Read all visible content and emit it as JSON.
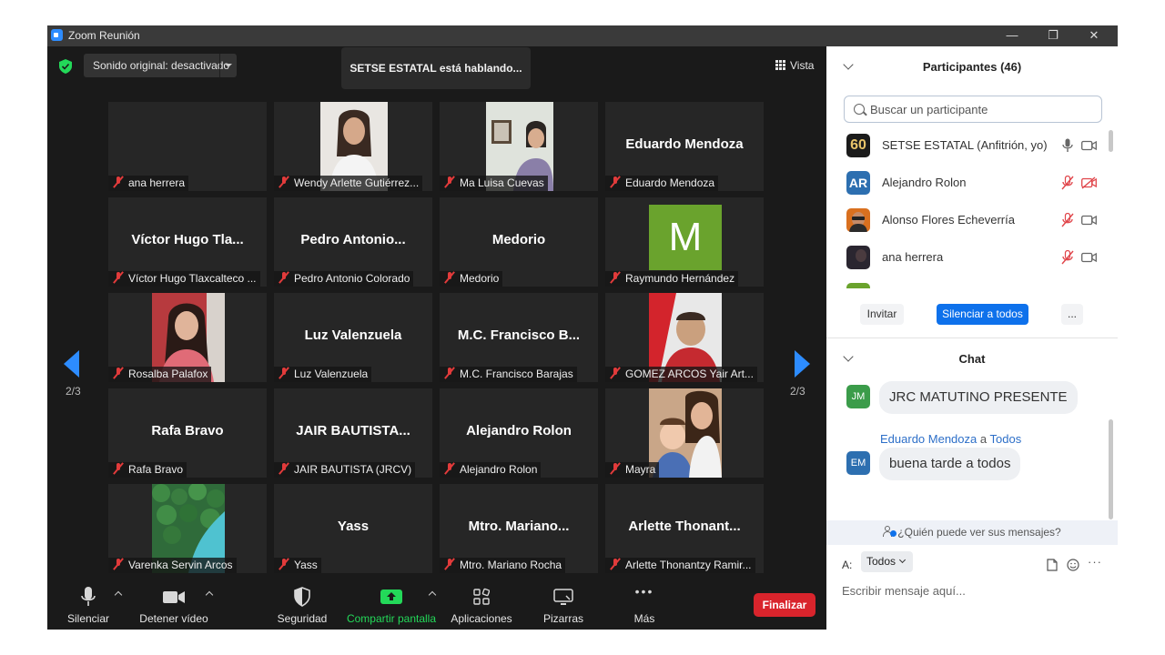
{
  "window": {
    "title": "Zoom Reunión",
    "controls": [
      "—",
      "❐",
      "✕"
    ]
  },
  "meeting": {
    "audio_label": "Sonido original: desactivado",
    "speaking": "SETSE ESTATAL está hablando...",
    "view_label": "Vista",
    "page_left": "2/3",
    "page_right": "2/3"
  },
  "tiles": [
    {
      "big": "",
      "name": "ana herrera"
    },
    {
      "big": "",
      "name": "Wendy  Arlette Gutiérrez..."
    },
    {
      "big": "",
      "name": "Ma Luisa Cuevas"
    },
    {
      "big": "Eduardo Mendoza",
      "name": "Eduardo Mendoza"
    },
    {
      "big": "Víctor  Hugo  Tla...",
      "name": "Víctor Hugo Tlaxcalteco ..."
    },
    {
      "big": "Pedro  Antonio...",
      "name": "Pedro Antonio Colorado"
    },
    {
      "big": "Medorio",
      "name": "Medorio"
    },
    {
      "big": "",
      "name": "Raymundo Hernández",
      "avatar_letter": "M"
    },
    {
      "big": "",
      "name": "Rosalba Palafox"
    },
    {
      "big": "Luz Valenzuela",
      "name": "Luz Valenzuela"
    },
    {
      "big": "M.C.  Francisco  B...",
      "name": "M.C. Francisco Barajas"
    },
    {
      "big": "",
      "name": "GOMEZ ARCOS Yair Art..."
    },
    {
      "big": "Rafa Bravo",
      "name": "Rafa Bravo"
    },
    {
      "big": "JAIR BAUTISTA...",
      "name": "JAIR BAUTISTA (JRCV)"
    },
    {
      "big": "Alejandro Rolon",
      "name": "Alejandro Rolon"
    },
    {
      "big": "",
      "name": "Mayra"
    },
    {
      "big": "",
      "name": "Varenka Servin Arcos"
    },
    {
      "big": "Yass",
      "name": "Yass"
    },
    {
      "big": "Mtro.  Mariano...",
      "name": "Mtro. Mariano Rocha"
    },
    {
      "big": "Arlette  Thonant...",
      "name": "Arlette Thonantzy Ramir..."
    }
  ],
  "toolbar": {
    "mute": "Silenciar",
    "video": "Detener vídeo",
    "security": "Seguridad",
    "share": "Compartir pantalla",
    "apps": "Aplicaciones",
    "whiteboards": "Pizarras",
    "more": "Más",
    "end": "Finalizar",
    "more_glyph": "•••"
  },
  "participants": {
    "title": "Participantes (46)",
    "search_placeholder": "Buscar un participante",
    "list": [
      {
        "name": "SETSE ESTATAL (Anfitrión, yo)",
        "initials": "60",
        "color": "#1b1b1b",
        "muted": false
      },
      {
        "name": "Alejandro Rolon",
        "initials": "AR",
        "color": "#2d6fb0",
        "muted": true
      },
      {
        "name": "Alonso Flores Echeverría",
        "initials": "",
        "color": "#d9701f",
        "muted": true
      },
      {
        "name": "ana herrera",
        "initials": "",
        "color": "#2a2630",
        "muted": true
      }
    ],
    "invite": "Invitar",
    "mute_all": "Silenciar a todos",
    "more": "..."
  },
  "chat": {
    "title": "Chat",
    "messages": [
      {
        "initials": "JM",
        "avatar_color": "#3b9c4a",
        "text": "JRC MATUTINO PRESENTE"
      },
      {
        "from": "Eduardo Mendoza",
        "to_word": "a",
        "to": "Todos",
        "initials": "EM",
        "avatar_color": "#2d6fb0",
        "text": "buena tarde a todos"
      }
    ],
    "who_can_see": "¿Quién puede ver sus mensajes?",
    "to_label": "A:",
    "to_value": "Todos",
    "input_placeholder": "Escribir mensaje aquí...",
    "compose_more": "···"
  }
}
